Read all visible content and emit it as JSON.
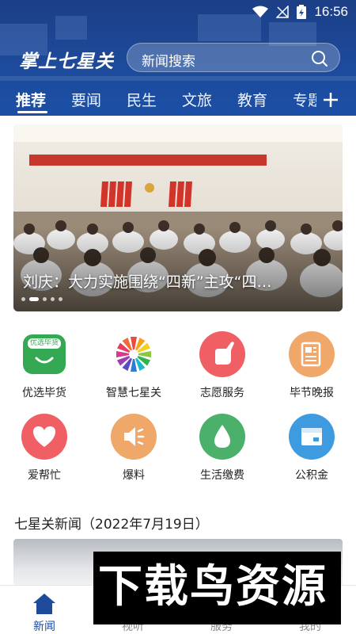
{
  "status_bar": {
    "time": "16:56"
  },
  "header": {
    "logo_text": "掌上七星关",
    "search_placeholder": "新闻搜索"
  },
  "tabs": [
    {
      "label": "推荐",
      "active": true
    },
    {
      "label": "要闻"
    },
    {
      "label": "民生"
    },
    {
      "label": "文旅"
    },
    {
      "label": "教育"
    }
  ],
  "tab_more": "专题",
  "banner": {
    "caption": "刘庆：大力实施围绕“四新”主攻“四…",
    "dots_total": 5,
    "dots_active": 1
  },
  "grid": [
    {
      "label": "优选毕货",
      "icon": "shop-bag-icon",
      "color": "#34a853",
      "badge": "优选毕货"
    },
    {
      "label": "智慧七星关",
      "icon": "pinwheel-logo-icon",
      "color": "#ffffff"
    },
    {
      "label": "志愿服务",
      "icon": "hand-icon",
      "color": "#ef5f63"
    },
    {
      "label": "毕节晚报",
      "icon": "newspaper-icon",
      "color": "#f0a86a"
    },
    {
      "label": "爱帮忙",
      "icon": "heart-icon",
      "color": "#ef5f63"
    },
    {
      "label": "爆料",
      "icon": "megaphone-icon",
      "color": "#f0a86a"
    },
    {
      "label": "生活缴费",
      "icon": "water-drop-icon",
      "color": "#4bb06a"
    },
    {
      "label": "公积金",
      "icon": "box-icon",
      "color": "#3e9be0"
    }
  ],
  "section": {
    "title": "七星关新闻（2022年7月19日）"
  },
  "bottom_nav": [
    {
      "label": "新闻",
      "icon": "home-icon",
      "active": true
    },
    {
      "label": "视听",
      "icon": "play-icon"
    },
    {
      "label": "服务",
      "icon": "grid-icon"
    },
    {
      "label": "我的",
      "icon": "user-icon"
    }
  ],
  "watermark": {
    "text": "下载鸟资源"
  },
  "colors": {
    "header_blue": "#1d4a9a",
    "accent_blue": "#1d4a9a"
  }
}
